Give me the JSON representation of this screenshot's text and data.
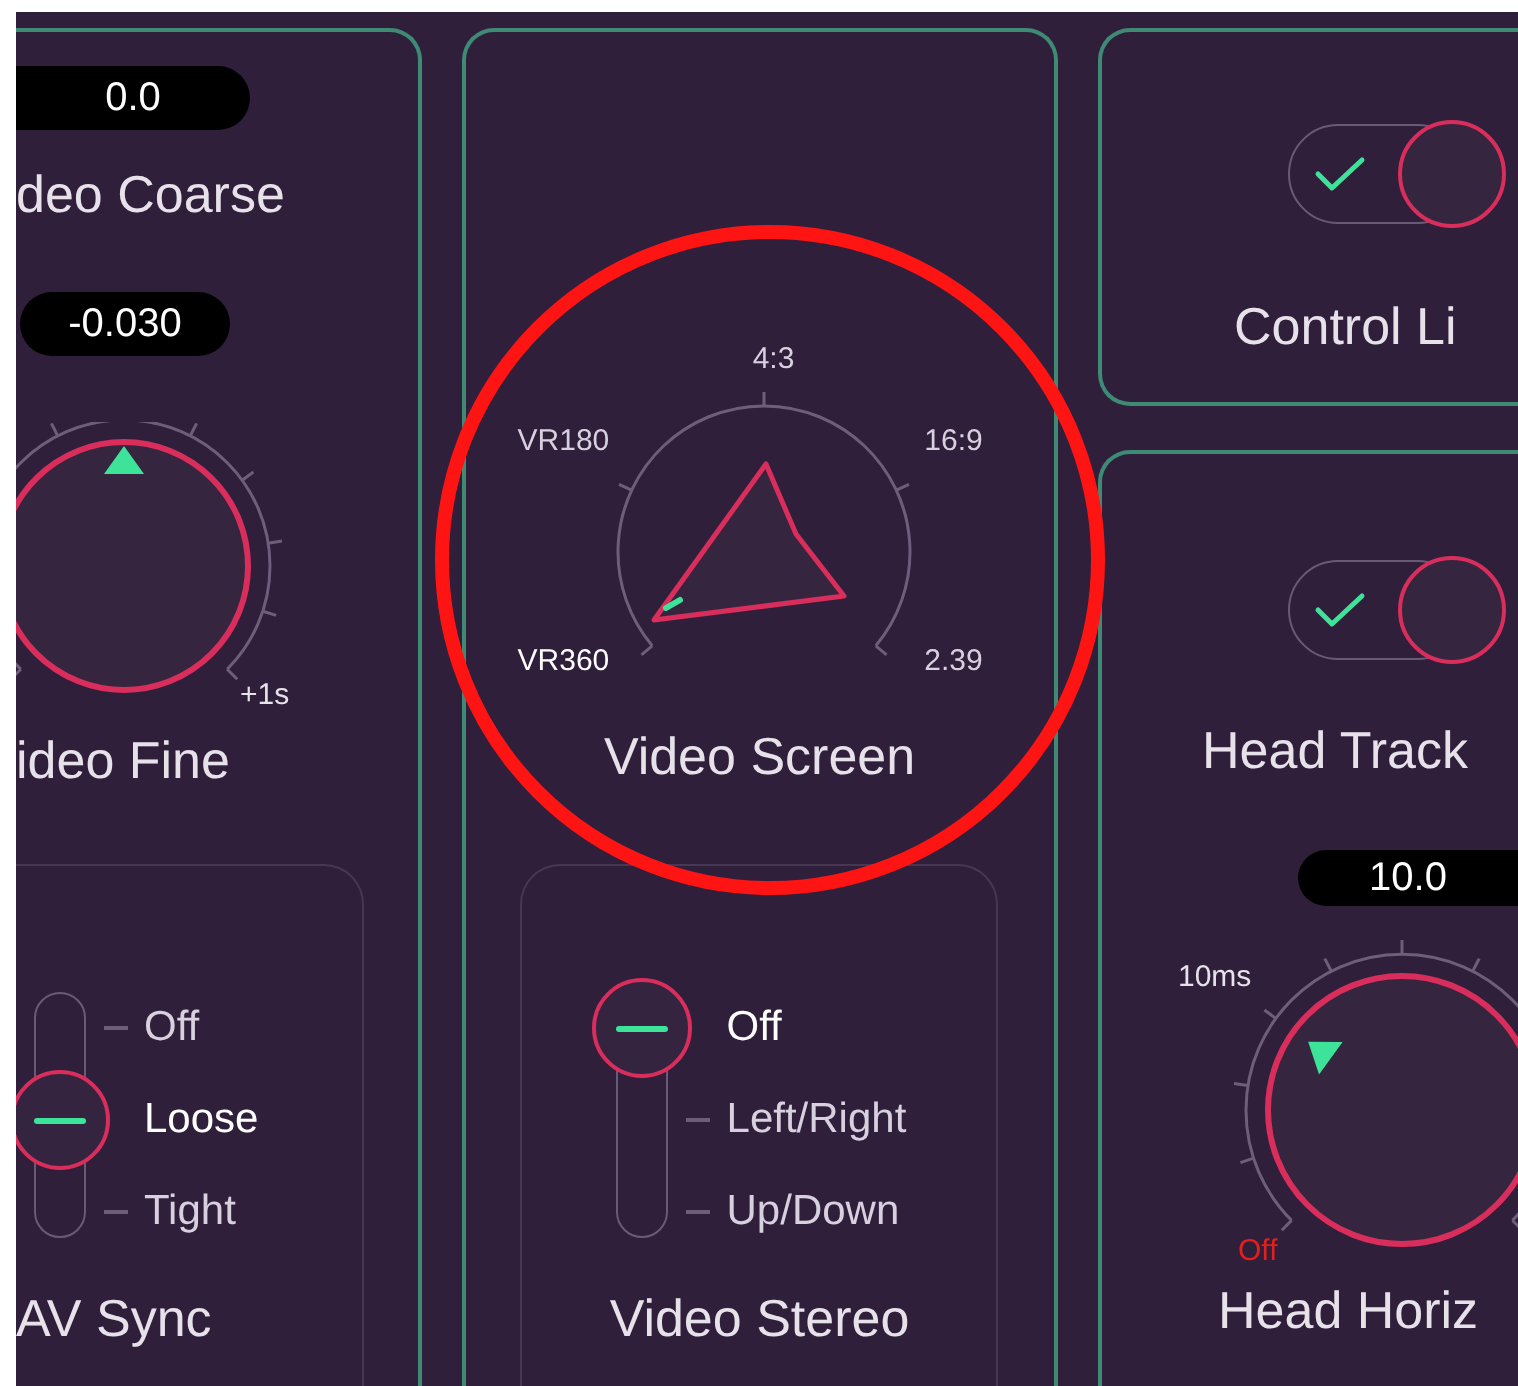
{
  "left_panel": {
    "video_coarse": {
      "value": "0.0",
      "label": "deo Coarse"
    },
    "video_fine": {
      "value": "-0.030",
      "label": "ideo Fine",
      "max_label": "+1s",
      "level": 0.5
    },
    "av_sync": {
      "label": "AV Sync",
      "options": [
        {
          "label": "Off",
          "selected": false
        },
        {
          "label": "Loose",
          "selected": true
        },
        {
          "label": "Tight",
          "selected": false
        }
      ]
    }
  },
  "middle_panel": {
    "video_screen": {
      "label": "Video Screen",
      "positions": [
        {
          "label": "VR360",
          "selected": true
        },
        {
          "label": "VR180",
          "selected": false
        },
        {
          "label": "4:3",
          "selected": false
        },
        {
          "label": "16:9",
          "selected": false
        },
        {
          "label": "2.39",
          "selected": false
        }
      ]
    },
    "video_stereo": {
      "label": "Video Stereo",
      "options": [
        {
          "label": "Off",
          "selected": true
        },
        {
          "label": "Left/Right",
          "selected": false
        },
        {
          "label": "Up/Down",
          "selected": false
        }
      ]
    }
  },
  "right_panel": {
    "control_link": {
      "label": "Control Li",
      "on": true
    },
    "head_tracking": {
      "label": "Head Track",
      "on": true
    },
    "head_horiz": {
      "value": "10.0",
      "min_label": "Off",
      "max_label": "10ms",
      "label": "Head Horiz",
      "level": 0.3
    }
  },
  "annotations": [
    {
      "kind": "circle"
    }
  ]
}
